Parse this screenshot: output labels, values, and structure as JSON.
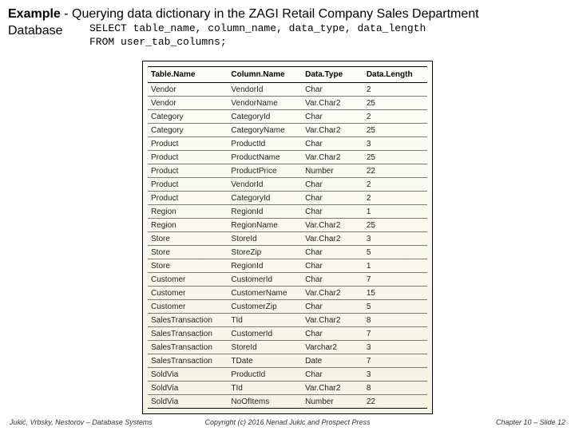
{
  "title": {
    "bold": "Example",
    "dash": "  - ",
    "rest1": "Querying data dictionary in the ZAGI Retail Company Sales Department",
    "rest2": "Database"
  },
  "sql": {
    "line1": "SELECT table_name, column_name, data_type, data_length",
    "line2": "FROM user_tab_columns;"
  },
  "table": {
    "headers": [
      "Table.Name",
      "Column.Name",
      "Data.Type",
      "Data.Length"
    ],
    "rows": [
      [
        "Vendor",
        "VendorId",
        "Char",
        "2"
      ],
      [
        "Vendor",
        "VendorName",
        "Var.Char2",
        "25"
      ],
      [
        "Category",
        "CategoryId",
        "Char",
        "2"
      ],
      [
        "Category",
        "CategoryName",
        "Var.Char2",
        "25"
      ],
      [
        "Product",
        "ProductId",
        "Char",
        "3"
      ],
      [
        "Product",
        "ProductName",
        "Var.Char2",
        "25"
      ],
      [
        "Product",
        "ProductPrice",
        "Number",
        "22"
      ],
      [
        "Product",
        "VendorId",
        "Char",
        "2"
      ],
      [
        "Product",
        "CategoryId",
        "Char",
        "2"
      ],
      [
        "Region",
        "RegionId",
        "Char",
        "1"
      ],
      [
        "Region",
        "RegionName",
        "Var.Char2",
        "25"
      ],
      [
        "Store",
        "StoreId",
        "Var.Char2",
        "3"
      ],
      [
        "Store",
        "StoreZip",
        "Char",
        "5"
      ],
      [
        "Store",
        "RegionId",
        "Char",
        "1"
      ],
      [
        "Customer",
        "CustomerId",
        "Char",
        "7"
      ],
      [
        "Customer",
        "CustomerName",
        "Var.Char2",
        "15"
      ],
      [
        "Customer",
        "CustomerZip",
        "Char",
        "5"
      ],
      [
        "SalesTransaction",
        "TId",
        "Var.Char2",
        "8"
      ],
      [
        "SalesTransaction",
        "CustomerId",
        "Char",
        "7"
      ],
      [
        "SalesTransaction",
        "StoreId",
        "Varchar2",
        "3"
      ],
      [
        "SalesTransaction",
        "TDate",
        "Date",
        "7"
      ],
      [
        "SoldVia",
        "ProductId",
        "Char",
        "3"
      ],
      [
        "SoldVia",
        "TId",
        "Var.Char2",
        "8"
      ],
      [
        "SoldVia",
        "NoOfItems",
        "Number",
        "22"
      ]
    ]
  },
  "footer": {
    "left": "Jukić, Vrbsky, Nestorov – Database Systems",
    "center": "Copyright (c) 2016 Nenad Jukic and Prospect Press",
    "right": "Chapter 10 – Slide 12"
  }
}
